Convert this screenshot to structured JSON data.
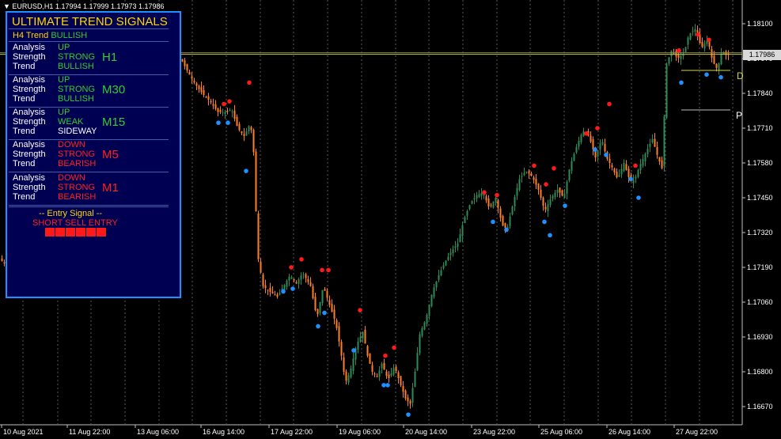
{
  "symbol_header": "EURUSD,H1  1.17994 1.17999 1.17973 1.17986",
  "current_price": "1.17986",
  "price_axis": [
    "1.18100",
    "1.17970",
    "1.17840",
    "1.17710",
    "1.17580",
    "1.17450",
    "1.17320",
    "1.17190",
    "1.17060",
    "1.16930",
    "1.16800",
    "1.16670"
  ],
  "time_axis": [
    "10 Aug 2021",
    "11 Aug 22:00",
    "13 Aug 06:00",
    "16 Aug 14:00",
    "17 Aug 22:00",
    "19 Aug 06:00",
    "20 Aug 14:00",
    "23 Aug 22:00",
    "25 Aug 06:00",
    "26 Aug 14:00",
    "27 Aug 22:00"
  ],
  "side_labels": {
    "d": "D",
    "p": "P"
  },
  "colors": {
    "background": "#000000",
    "bull": "#2e8b57",
    "bear": "#ff7f27",
    "sell_dot": "#ff1a1a",
    "buy_dot": "#1e90ff",
    "panel_bg": "#000052",
    "panel_border": "#1e90ff",
    "gold": "#ffd700",
    "green": "#32cd32",
    "red": "#ff2020",
    "white": "#ffffff"
  },
  "panel": {
    "title": "ULTIMATE TREND SIGNALS",
    "h4": {
      "label": "H4 Trend",
      "value": "BULLISH"
    },
    "blocks": [
      {
        "tf": "H1",
        "analysis": "UP",
        "strength": "STRONG",
        "trend": "BULLISH",
        "tf_color": "#32cd32",
        "analysis_color": "#32cd32",
        "strength_color": "#32cd32",
        "trend_color": "#32cd32"
      },
      {
        "tf": "M30",
        "analysis": "UP",
        "strength": "STRONG",
        "trend": "BULLISH",
        "tf_color": "#32cd32",
        "analysis_color": "#32cd32",
        "strength_color": "#32cd32",
        "trend_color": "#32cd32"
      },
      {
        "tf": "M15",
        "analysis": "UP",
        "strength": "WEAK",
        "trend": "SIDEWAY",
        "tf_color": "#32cd32",
        "analysis_color": "#32cd32",
        "strength_color": "#32cd32",
        "trend_color": "#ffffff"
      },
      {
        "tf": "M5",
        "analysis": "DOWN",
        "strength": "STRONG",
        "trend": "BEARISH",
        "tf_color": "#ff2020",
        "analysis_color": "#ff2020",
        "strength_color": "#ff2020",
        "trend_color": "#ff2020"
      },
      {
        "tf": "M1",
        "analysis": "DOWN",
        "strength": "STRONG",
        "trend": "BEARISH",
        "tf_color": "#ff2020",
        "analysis_color": "#ff2020",
        "strength_color": "#ff2020",
        "trend_color": "#ff2020"
      }
    ],
    "labels": {
      "analysis": "Analysis",
      "strength": "Strength",
      "trend": "Trend"
    },
    "entry_title": "-- Entry Signal --",
    "entry_text": "SHORT SELL ENTRY"
  },
  "price_path": [
    [
      0,
      1.1722
    ],
    [
      10,
      1.1719
    ],
    [
      20,
      1.1716
    ],
    [
      30,
      1.1718
    ],
    [
      40,
      1.1717
    ],
    [
      50,
      1.1713
    ],
    [
      55,
      1.1709
    ],
    [
      62,
      1.1714
    ],
    [
      68,
      1.172
    ],
    [
      72,
      1.1736
    ],
    [
      80,
      1.1741
    ],
    [
      90,
      1.1738
    ],
    [
      100,
      1.1736
    ],
    [
      110,
      1.1732
    ],
    [
      120,
      1.1729
    ],
    [
      130,
      1.1731
    ],
    [
      140,
      1.1733
    ],
    [
      150,
      1.1735
    ],
    [
      160,
      1.1738
    ],
    [
      170,
      1.1736
    ],
    [
      180,
      1.1733
    ],
    [
      185,
      1.1737
    ],
    [
      192,
      1.1748
    ],
    [
      200,
      1.1775
    ],
    [
      205,
      1.1793
    ],
    [
      210,
      1.18
    ],
    [
      220,
      1.1798
    ],
    [
      228,
      1.1797
    ],
    [
      235,
      1.1793
    ],
    [
      245,
      1.1788
    ],
    [
      255,
      1.1784
    ],
    [
      265,
      1.1781
    ],
    [
      275,
      1.1777
    ],
    [
      285,
      1.1777
    ],
    [
      292,
      1.1778
    ],
    [
      300,
      1.1771
    ],
    [
      308,
      1.1768
    ],
    [
      316,
      1.1773
    ],
    [
      320,
      1.1762
    ],
    [
      323,
      1.174
    ],
    [
      326,
      1.1722
    ],
    [
      332,
      1.1712
    ],
    [
      340,
      1.171
    ],
    [
      350,
      1.1708
    ],
    [
      358,
      1.1712
    ],
    [
      366,
      1.1716
    ],
    [
      374,
      1.1713
    ],
    [
      382,
      1.1717
    ],
    [
      392,
      1.1712
    ],
    [
      400,
      1.17
    ],
    [
      408,
      1.1712
    ],
    [
      416,
      1.1705
    ],
    [
      424,
      1.1698
    ],
    [
      430,
      1.1688
    ],
    [
      436,
      1.1676
    ],
    [
      442,
      1.168
    ],
    [
      450,
      1.169
    ],
    [
      458,
      1.1695
    ],
    [
      464,
      1.1686
    ],
    [
      470,
      1.168
    ],
    [
      476,
      1.1678
    ],
    [
      482,
      1.1683
    ],
    [
      490,
      1.1677
    ],
    [
      498,
      1.1682
    ],
    [
      506,
      1.1675
    ],
    [
      512,
      1.167
    ],
    [
      518,
      1.1668
    ],
    [
      524,
      1.168
    ],
    [
      530,
      1.1694
    ],
    [
      538,
      1.17
    ],
    [
      546,
      1.171
    ],
    [
      554,
      1.1716
    ],
    [
      562,
      1.1721
    ],
    [
      570,
      1.1725
    ],
    [
      578,
      1.1728
    ],
    [
      586,
      1.1737
    ],
    [
      594,
      1.1743
    ],
    [
      602,
      1.1746
    ],
    [
      610,
      1.1747
    ],
    [
      618,
      1.1741
    ],
    [
      626,
      1.1745
    ],
    [
      634,
      1.1735
    ],
    [
      640,
      1.1733
    ],
    [
      648,
      1.1743
    ],
    [
      656,
      1.1752
    ],
    [
      664,
      1.1755
    ],
    [
      672,
      1.1753
    ],
    [
      680,
      1.1748
    ],
    [
      688,
      1.174
    ],
    [
      696,
      1.1745
    ],
    [
      704,
      1.1748
    ],
    [
      712,
      1.1745
    ],
    [
      720,
      1.1757
    ],
    [
      728,
      1.1764
    ],
    [
      736,
      1.177
    ],
    [
      744,
      1.1768
    ],
    [
      752,
      1.176
    ],
    [
      760,
      1.1767
    ],
    [
      766,
      1.176
    ],
    [
      772,
      1.1757
    ],
    [
      780,
      1.1752
    ],
    [
      788,
      1.1758
    ],
    [
      796,
      1.1751
    ],
    [
      802,
      1.1752
    ],
    [
      808,
      1.1757
    ],
    [
      816,
      1.1762
    ],
    [
      824,
      1.1767
    ],
    [
      830,
      1.1761
    ],
    [
      836,
      1.1756
    ],
    [
      842,
      1.1795
    ],
    [
      848,
      1.18
    ],
    [
      856,
      1.1797
    ],
    [
      864,
      1.1799
    ],
    [
      870,
      1.1806
    ],
    [
      878,
      1.1808
    ],
    [
      886,
      1.1801
    ],
    [
      894,
      1.1804
    ],
    [
      900,
      1.1796
    ],
    [
      906,
      1.1793
    ],
    [
      912,
      1.18
    ],
    [
      918,
      1.1798
    ],
    [
      922,
      1.1799
    ]
  ],
  "sell_dots": [
    [
      283,
      1.178
    ],
    [
      290,
      1.1781
    ],
    [
      315,
      1.1788
    ],
    [
      368,
      1.1719
    ],
    [
      381,
      1.1722
    ],
    [
      407,
      1.1718
    ],
    [
      415,
      1.1718
    ],
    [
      455,
      1.1703
    ],
    [
      487,
      1.1686
    ],
    [
      498,
      1.1689
    ],
    [
      612,
      1.1747
    ],
    [
      628,
      1.1746
    ],
    [
      675,
      1.1757
    ],
    [
      690,
      1.175
    ],
    [
      700,
      1.1756
    ],
    [
      741,
      1.1769
    ],
    [
      755,
      1.1771
    ],
    [
      770,
      1.178
    ],
    [
      803,
      1.1757
    ],
    [
      858,
      1.18
    ],
    [
      882,
      1.1806
    ],
    [
      896,
      1.1804
    ]
  ],
  "buy_dots": [
    [
      276,
      1.1773
    ],
    [
      288,
      1.1773
    ],
    [
      311,
      1.1755
    ],
    [
      358,
      1.171
    ],
    [
      370,
      1.1711
    ],
    [
      402,
      1.1697
    ],
    [
      410,
      1.1702
    ],
    [
      447,
      1.1688
    ],
    [
      485,
      1.1675
    ],
    [
      490,
      1.1675
    ],
    [
      516,
      1.1664
    ],
    [
      623,
      1.1736
    ],
    [
      640,
      1.1733
    ],
    [
      688,
      1.1736
    ],
    [
      695,
      1.1731
    ],
    [
      714,
      1.1742
    ],
    [
      752,
      1.1763
    ],
    [
      766,
      1.1761
    ],
    [
      797,
      1.1752
    ],
    [
      807,
      1.1745
    ],
    [
      861,
      1.1788
    ],
    [
      893,
      1.1791
    ],
    [
      911,
      1.179
    ]
  ]
}
